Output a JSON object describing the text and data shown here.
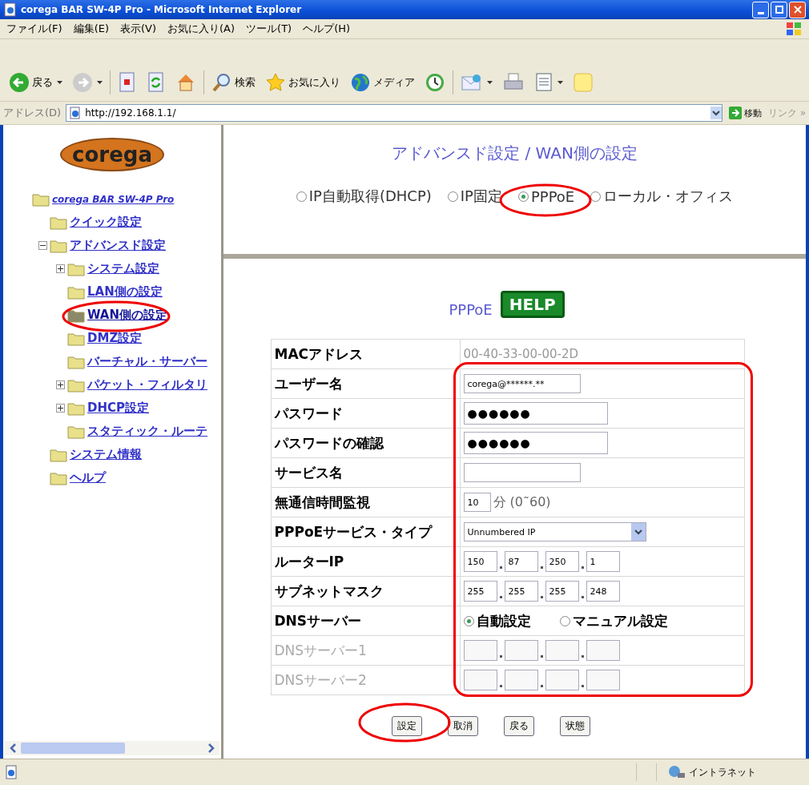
{
  "window": {
    "title": "corega BAR SW-4P Pro - Microsoft Internet Explorer"
  },
  "menu": [
    "ファイル(F)",
    "編集(E)",
    "表示(V)",
    "お気に入り(A)",
    "ツール(T)",
    "ヘルプ(H)"
  ],
  "toolbar": [
    {
      "kind": "back",
      "label": "戻る",
      "dropdown": true
    },
    {
      "kind": "forward",
      "dropdown": true
    },
    {
      "kind": "separator"
    },
    {
      "kind": "stop",
      "dropdown": false
    },
    {
      "kind": "refresh",
      "dropdown": false
    },
    {
      "kind": "home",
      "dropdown": false
    },
    {
      "kind": "separator"
    },
    {
      "kind": "search",
      "label": "検索",
      "dropdown": false
    },
    {
      "kind": "favorites",
      "label": "お気に入り",
      "dropdown": false
    },
    {
      "kind": "media",
      "label": "メディア",
      "dropdown": false
    },
    {
      "kind": "history",
      "dropdown": false
    },
    {
      "kind": "separator"
    },
    {
      "kind": "mail",
      "dropdown": true
    },
    {
      "kind": "print",
      "dropdown": false
    },
    {
      "kind": "edit",
      "dropdown": true
    },
    {
      "kind": "messenger",
      "dropdown": false
    }
  ],
  "address": {
    "label": "アドレス(D)",
    "url": "http://192.168.1.1/",
    "go": "移動",
    "links": "リンク »"
  },
  "sidebar": {
    "logo": "corega",
    "tree": [
      {
        "label": "corega BAR SW-4P Pro",
        "selected": false,
        "children": [
          {
            "label": "クイック設定",
            "selected": false
          },
          {
            "label": "アドバンスド設定",
            "selected": false,
            "expanded": true,
            "children": [
              {
                "label": "システム設定",
                "selected": false,
                "expanded": false
              },
              {
                "label": "LAN側の設定",
                "selected": false
              },
              {
                "label": "WAN側の設定",
                "selected": true
              },
              {
                "label": "DMZ設定",
                "selected": false
              },
              {
                "label": "バーチャル・サーバー",
                "selected": false
              },
              {
                "label": "パケット・フィルタリ",
                "selected": false,
                "expanded": false
              },
              {
                "label": "DHCP設定",
                "selected": false,
                "expanded": false
              },
              {
                "label": "スタティック・ルーテ",
                "selected": false
              }
            ]
          },
          {
            "label": "システム情報",
            "selected": false
          },
          {
            "label": "ヘルプ",
            "selected": false
          }
        ]
      }
    ]
  },
  "header": {
    "title": "アドバンスド設定 / WAN側の設定",
    "modes": [
      {
        "label": "IP自動取得(DHCP)",
        "selected": false
      },
      {
        "label": "IP固定",
        "selected": false
      },
      {
        "label": "PPPoE",
        "selected": true
      },
      {
        "label": "ローカル・オフィス",
        "selected": false
      }
    ]
  },
  "form": {
    "title": "PPPoE",
    "help": "HELP",
    "rows": [
      {
        "kind": "text",
        "label": "MACアドレス",
        "value": "00-40-33-00-00-2D",
        "disabled": false
      },
      {
        "kind": "input",
        "label": "ユーザー名",
        "value": "corega@******.**",
        "disabled": false
      },
      {
        "kind": "password",
        "label": "パスワード",
        "value": "●●●●●●",
        "disabled": false
      },
      {
        "kind": "password",
        "label": "パスワードの確認",
        "value": "●●●●●●",
        "disabled": false
      },
      {
        "kind": "input",
        "label": "サービス名",
        "disabled": false
      },
      {
        "kind": "minutes",
        "label": "無通信時間監視",
        "value": "10",
        "unit": "分 (0˜60)",
        "disabled": false
      },
      {
        "kind": "select",
        "label": "PPPoEサービス・タイプ",
        "value": "Unnumbered IP",
        "disabled": false
      },
      {
        "kind": "ip",
        "label": "ルーターIP",
        "octets": [
          "150",
          "87",
          "250",
          "1"
        ],
        "disabled": false
      },
      {
        "kind": "ip",
        "label": "サブネットマスク",
        "octets": [
          "255",
          "255",
          "255",
          "248"
        ],
        "disabled": false
      },
      {
        "kind": "radio",
        "label": "DNSサーバー",
        "options": [
          {
            "label": "自動設定",
            "selected": true
          },
          {
            "label": "マニュアル設定",
            "selected": false
          }
        ],
        "disabled": false
      },
      {
        "kind": "ip",
        "label": "DNSサーバー1",
        "disabled": true
      },
      {
        "kind": "ip",
        "label": "DNSサーバー2",
        "disabled": true
      }
    ],
    "buttons": [
      "設定",
      "取消",
      "戻る",
      "状態"
    ]
  },
  "status_bar": {
    "zone": "イントラネット"
  }
}
